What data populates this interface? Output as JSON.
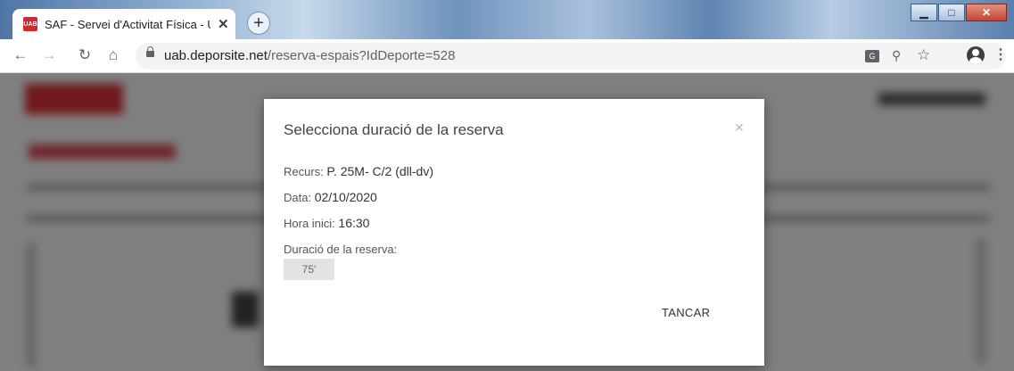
{
  "browser": {
    "tab": {
      "favicon_text": "UAB",
      "title": "SAF - Servei d'Activitat Física - U",
      "close_icon": "close-icon"
    },
    "new_tab_icon": "plus-icon",
    "window_controls": {
      "minimize": "minimize-icon",
      "maximize": "maximize-icon",
      "close": "close-icon"
    },
    "toolbar": {
      "back": "back-arrow-icon",
      "forward": "forward-arrow-icon",
      "reload": "reload-icon",
      "home": "home-icon"
    },
    "address": {
      "host": "uab.deporsite.net",
      "path": "/reserva-espais?IdDeporte=528"
    },
    "toolbar_right": {
      "translate": "translate-icon",
      "zoom": "zoom-icon",
      "bookmark": "star-icon",
      "profile": "profile-icon",
      "menu": "more-menu-icon"
    }
  },
  "modal": {
    "title": "Selecciona duració de la reserva",
    "close_icon": "close-icon",
    "resource_label": "Recurs:",
    "resource_value": "P. 25M- C/2 (dll-dv)",
    "date_label": "Data:",
    "date_value": "02/10/2020",
    "start_label": "Hora inici:",
    "start_value": "16:30",
    "duration_label": "Duració de la reserva:",
    "duration_options": [
      "75'"
    ],
    "close_button": "TANCAR"
  },
  "colors": {
    "brand_red": "#d7262e",
    "overlay": "rgba(0,0,0,0.5)",
    "duration_pill_bg": "#e3e3e3"
  }
}
